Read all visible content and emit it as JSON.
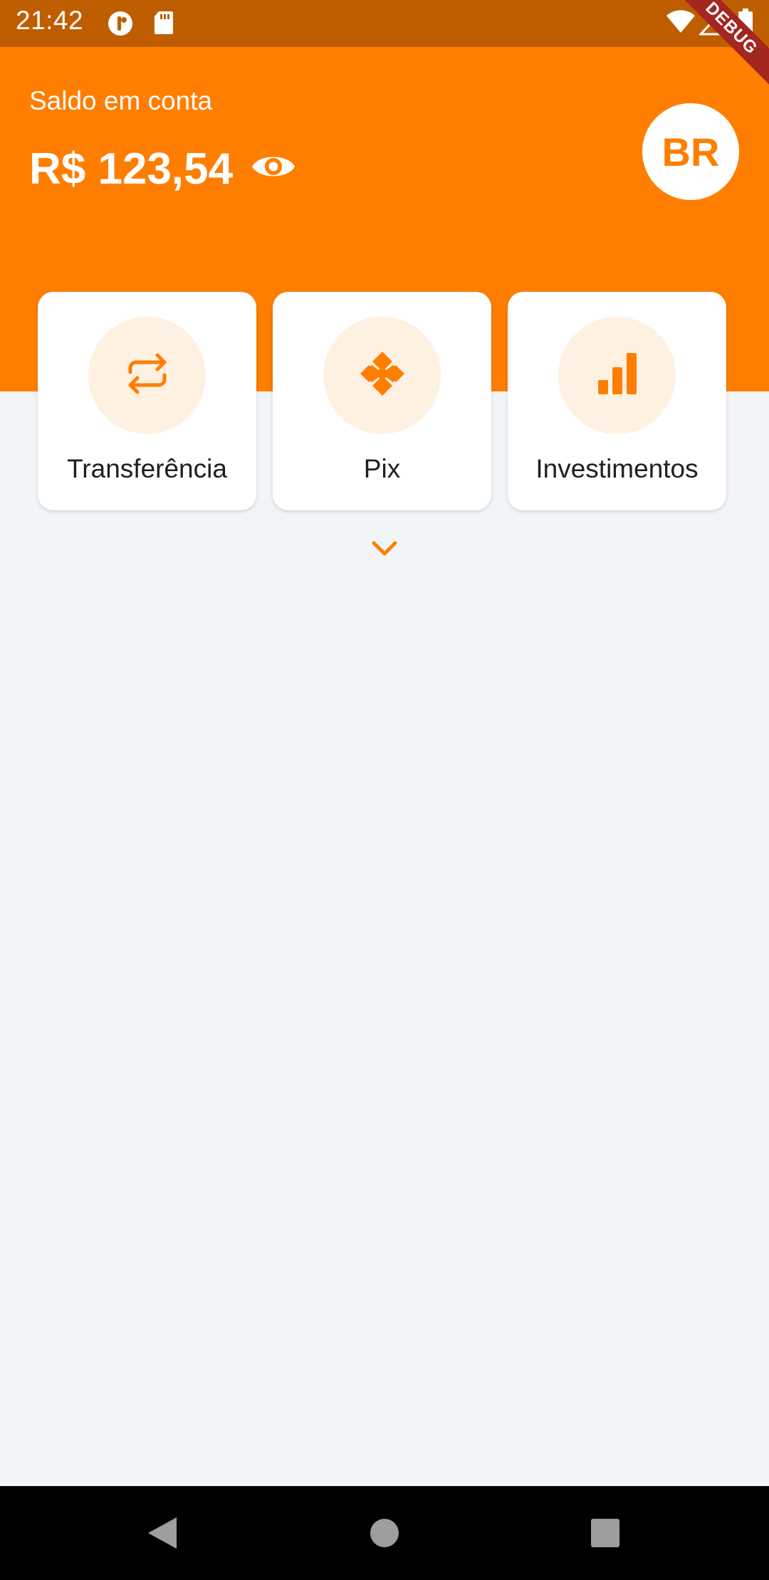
{
  "status_bar": {
    "time": "21:42",
    "icons": [
      "app-notification-icon",
      "sd-card-icon",
      "wifi-icon",
      "signal-icon",
      "battery-icon"
    ],
    "debug_label": "DEBUG"
  },
  "header": {
    "balance_label": "Saldo em conta",
    "balance_value": "R$ 123,54",
    "visibility_icon": "eye-icon",
    "avatar_initials": "BR"
  },
  "actions": [
    {
      "label": "Transferência",
      "icon": "transfer-icon"
    },
    {
      "label": "Pix",
      "icon": "pix-icon"
    },
    {
      "label": "Investimentos",
      "icon": "bar-chart-icon"
    }
  ],
  "expand_icon": "chevron-down-icon",
  "navigation": {
    "buttons": [
      "back-icon",
      "home-icon",
      "recents-icon"
    ]
  },
  "colors": {
    "accent": "#FF7E00",
    "status_bar": "#BF5E00",
    "background": "#F2F5F8",
    "icon_circle": "#FFF1E2",
    "debug_banner": "#A3261F"
  }
}
